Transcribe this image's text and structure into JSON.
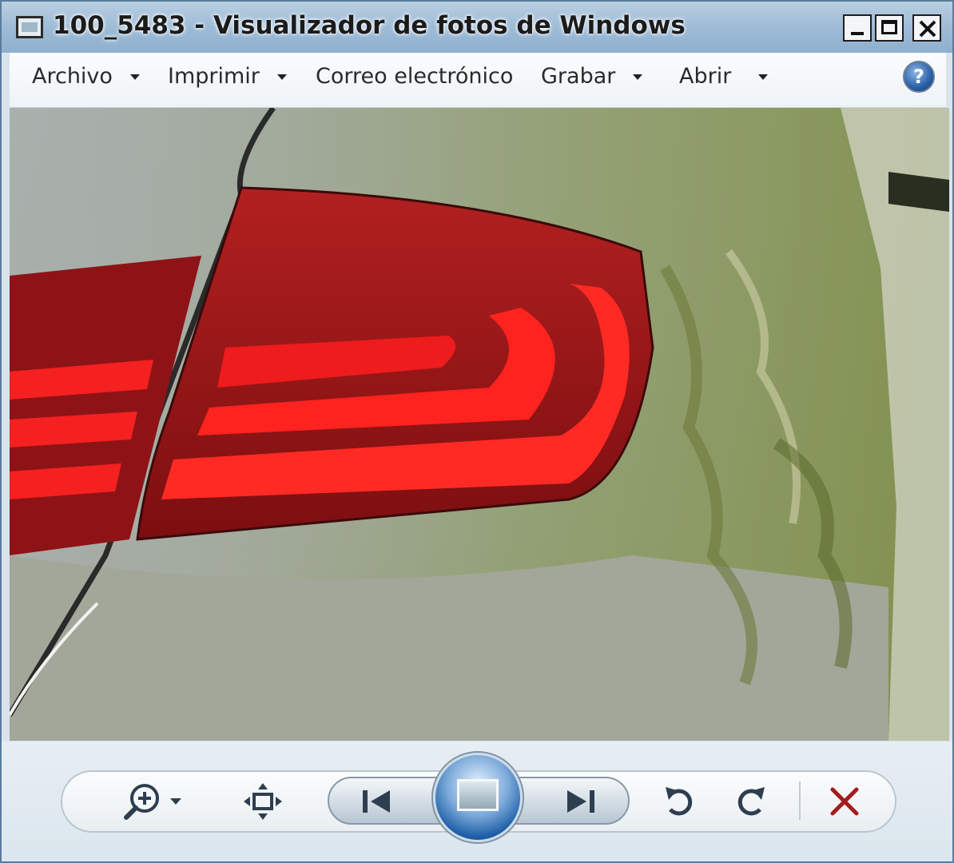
{
  "window": {
    "title": "100_5483 - Visualizador de fotos de Windows",
    "app_icon": "photo-viewer-icon",
    "controls": [
      "minimize-icon",
      "maximize-icon",
      "close-icon"
    ]
  },
  "menu": {
    "items": [
      {
        "label": "Archivo",
        "has_dropdown": true
      },
      {
        "label": "Imprimir",
        "has_dropdown": true
      },
      {
        "label": "Correo electrónico",
        "has_dropdown": false
      },
      {
        "label": "Grabar",
        "has_dropdown": true
      },
      {
        "label": "Abrir",
        "has_dropdown": true
      }
    ],
    "help_icon": "help-icon",
    "help_glyph": "?"
  },
  "photo": {
    "subject": "car-tail-light"
  },
  "toolbar": {
    "buttons": [
      {
        "name": "zoom-button",
        "icon": "magnifier-plus-icon"
      },
      {
        "name": "actual-size-button",
        "icon": "fit-to-window-icon"
      },
      {
        "name": "previous-button",
        "icon": "previous-icon"
      },
      {
        "name": "slideshow-button",
        "icon": "slideshow-icon"
      },
      {
        "name": "next-button",
        "icon": "next-icon"
      },
      {
        "name": "rotate-left-button",
        "icon": "rotate-ccw-icon"
      },
      {
        "name": "rotate-right-button",
        "icon": "rotate-cw-icon"
      },
      {
        "name": "delete-button",
        "icon": "delete-x-icon"
      }
    ],
    "colors": {
      "delete": "#a31c1c",
      "accent": "#1e5fa8",
      "icon": "#2d3e4f"
    }
  }
}
